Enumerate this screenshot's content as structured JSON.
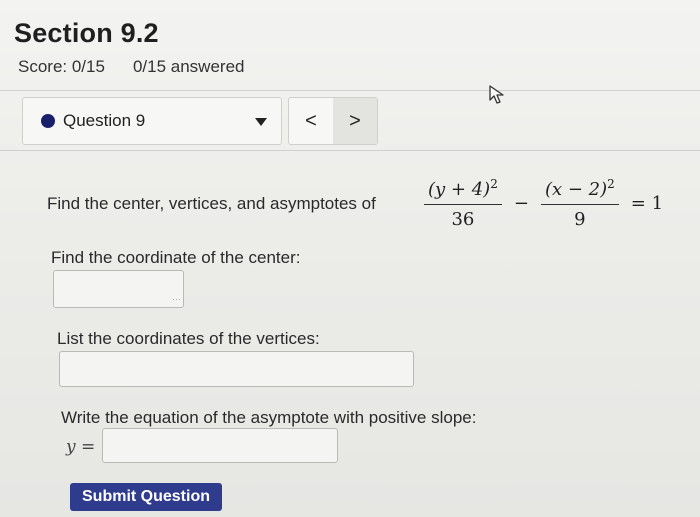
{
  "header": {
    "title": "Section 9.2",
    "score": "Score: 0/15",
    "answered": "0/15 answered"
  },
  "question_nav": {
    "label": "Question 9",
    "prev_symbol": "<",
    "next_symbol": ">"
  },
  "question": {
    "prompt": "Find the center, vertices, and asymptotes of",
    "equation": {
      "term1_numerator": "(y + 4)",
      "term1_power": "2",
      "term1_denominator": "36",
      "operator": "−",
      "term2_numerator": "(x − 2)",
      "term2_power": "2",
      "term2_denominator": "9",
      "rhs": "= 1"
    }
  },
  "parts": {
    "center_label": "Find the coordinate of the center:",
    "center_value": "",
    "vertices_label": "List the coordinates of the vertices:",
    "vertices_value": "",
    "asymptote_label": "Write the equation of the asymptote with positive slope:",
    "asymptote_prefix": "y =",
    "asymptote_value": ""
  },
  "submit_label": "Submit Question",
  "colors": {
    "accent": "#2f3b8c",
    "question_dot": "#1a1f6b"
  }
}
